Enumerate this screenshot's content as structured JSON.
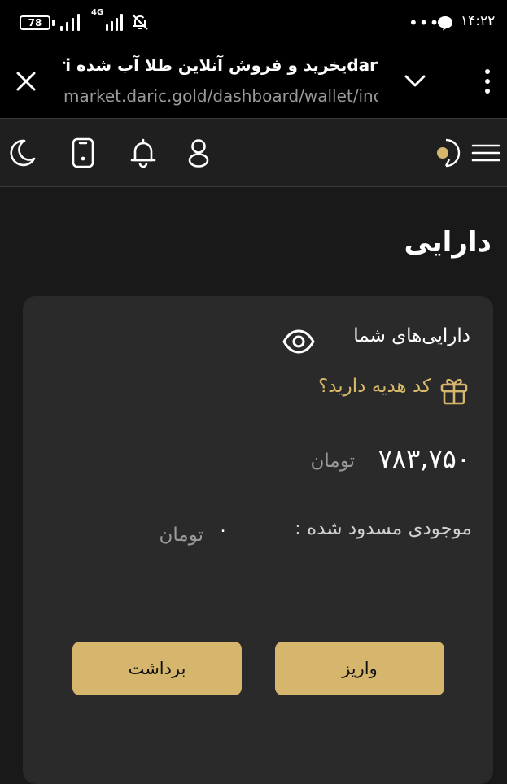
{
  "status_bar": {
    "battery": "78",
    "network": "4G",
    "more": "•••",
    "time": "۱۴:۲۲"
  },
  "browser": {
    "title": "darيخرید و فروش آنلاین طلا آب شده dari",
    "url": "market.daric.gold/dashboard/wallet/inde",
    "icons": [
      "close-icon",
      "chevron-down-icon",
      "kebab-menu-icon"
    ]
  },
  "header": {
    "icons": [
      "moon-icon",
      "mobile-icon",
      "bell-icon",
      "user-icon",
      "logo-icon",
      "hamburger-icon"
    ]
  },
  "page": {
    "title": "دارایی"
  },
  "wallet": {
    "assets_label": "دارایی‌های شما",
    "gift_label": "کد هدیه دارید؟",
    "balance": "۷۸۳,۷۵۰",
    "balance_unit": "تومان",
    "blocked_label": "موجودی مسدود شده :",
    "blocked_amount": "۰",
    "blocked_unit": "تومان",
    "deposit_label": "واریز",
    "withdraw_label": "برداشت"
  },
  "colors": {
    "accent_gold": "#d6b56c",
    "gift_text": "#d8b96a",
    "background": "#191919",
    "card": "#2a2a2a"
  }
}
